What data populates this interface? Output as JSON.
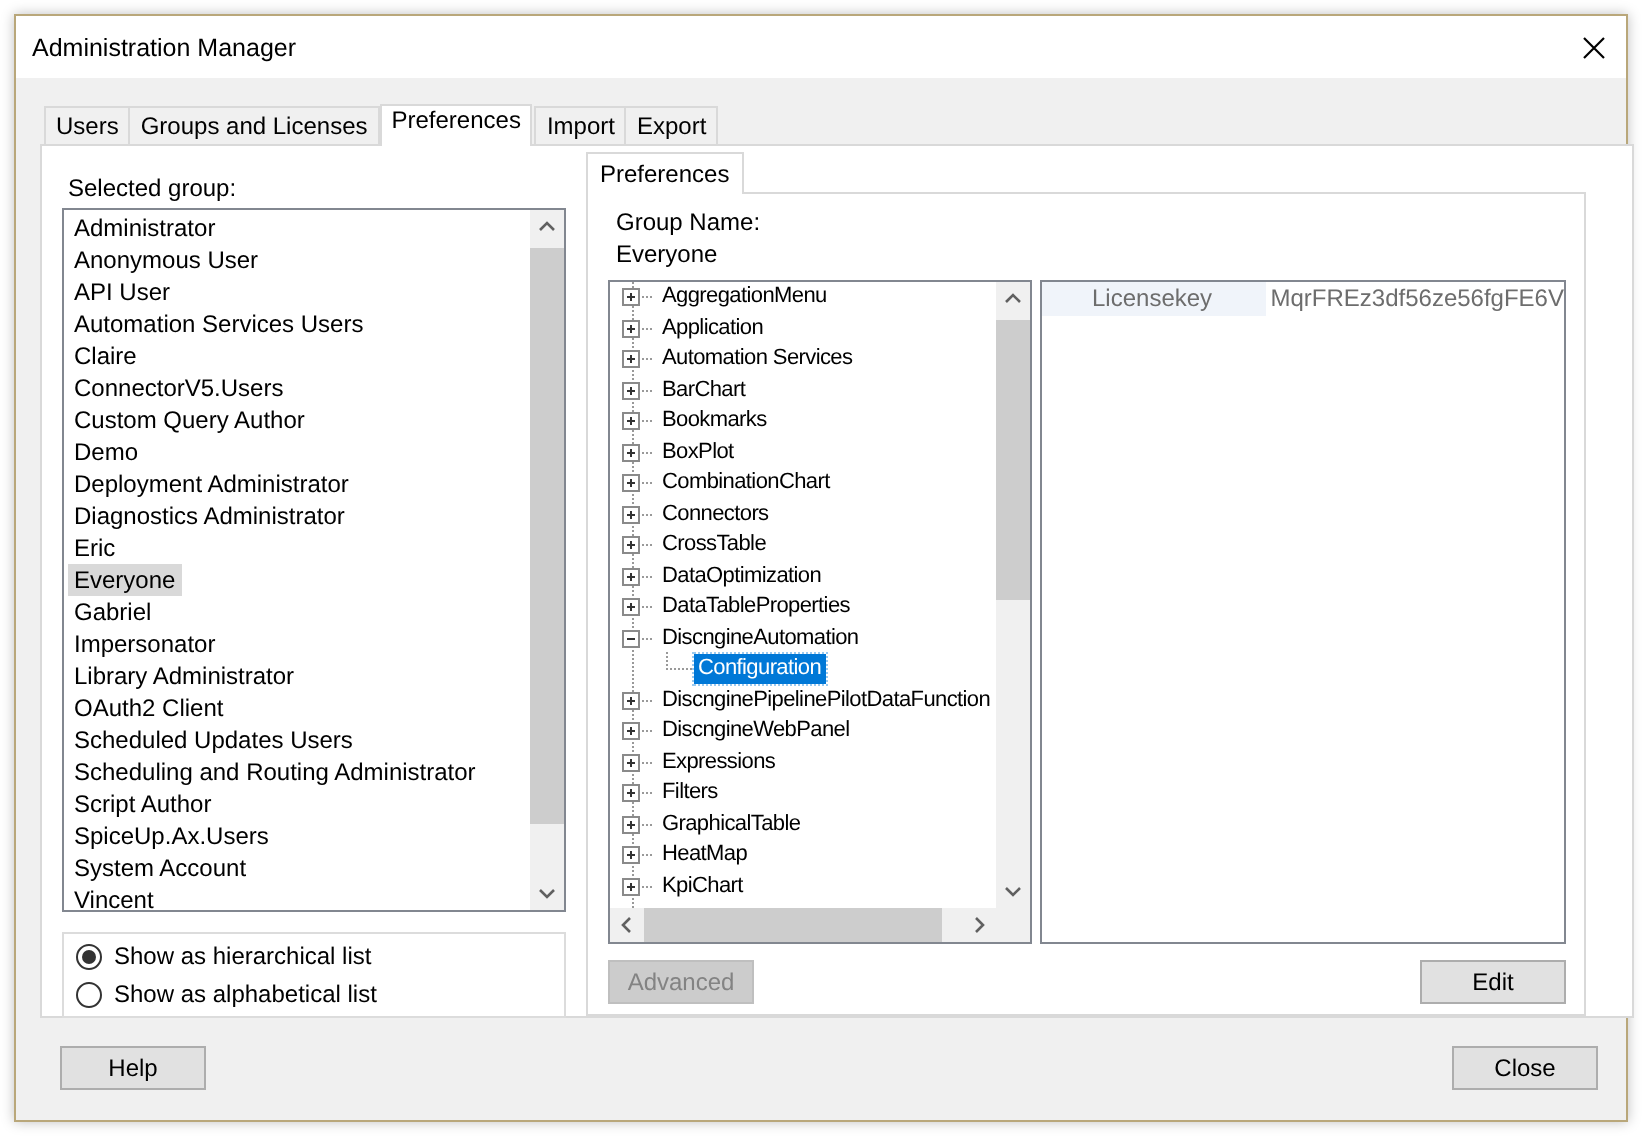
{
  "window": {
    "title": "Administration Manager"
  },
  "tabs": [
    {
      "label": "Users",
      "selected": false
    },
    {
      "label": "Groups and Licenses",
      "selected": false
    },
    {
      "label": "Preferences",
      "selected": true
    },
    {
      "label": "Import",
      "selected": false
    },
    {
      "label": "Export",
      "selected": false
    }
  ],
  "groups": {
    "label": "Selected group:",
    "items": [
      {
        "label": "Administrator",
        "selected": false
      },
      {
        "label": "Anonymous User",
        "selected": false
      },
      {
        "label": "API User",
        "selected": false
      },
      {
        "label": "Automation Services Users",
        "selected": false
      },
      {
        "label": "Claire",
        "selected": false
      },
      {
        "label": "ConnectorV5.Users",
        "selected": false
      },
      {
        "label": "Custom Query Author",
        "selected": false
      },
      {
        "label": "Demo",
        "selected": false
      },
      {
        "label": "Deployment Administrator",
        "selected": false
      },
      {
        "label": "Diagnostics Administrator",
        "selected": false
      },
      {
        "label": "Eric",
        "selected": false
      },
      {
        "label": "Everyone",
        "selected": true
      },
      {
        "label": "Gabriel",
        "selected": false
      },
      {
        "label": "Impersonator",
        "selected": false
      },
      {
        "label": "Library Administrator",
        "selected": false
      },
      {
        "label": "OAuth2 Client",
        "selected": false
      },
      {
        "label": "Scheduled Updates Users",
        "selected": false
      },
      {
        "label": "Scheduling and Routing Administrator",
        "selected": false
      },
      {
        "label": "Script Author",
        "selected": false
      },
      {
        "label": "SpiceUp.Ax.Users",
        "selected": false
      },
      {
        "label": "System Account",
        "selected": false
      },
      {
        "label": "Vincent",
        "selected": false
      }
    ]
  },
  "view_options": [
    {
      "label": "Show as hierarchical list",
      "selected": true
    },
    {
      "label": "Show as alphabetical list",
      "selected": false
    }
  ],
  "preferences": {
    "tab": "Preferences",
    "group_name_label": "Group Name:",
    "group_name": "Everyone",
    "tree": [
      {
        "label": "AggregationMenu",
        "expanded": false,
        "selected": false
      },
      {
        "label": "Application",
        "expanded": false,
        "selected": false
      },
      {
        "label": "Automation Services",
        "expanded": false,
        "selected": false
      },
      {
        "label": "BarChart",
        "expanded": false,
        "selected": false
      },
      {
        "label": "Bookmarks",
        "expanded": false,
        "selected": false
      },
      {
        "label": "BoxPlot",
        "expanded": false,
        "selected": false
      },
      {
        "label": "CombinationChart",
        "expanded": false,
        "selected": false
      },
      {
        "label": "Connectors",
        "expanded": false,
        "selected": false
      },
      {
        "label": "CrossTable",
        "expanded": false,
        "selected": false
      },
      {
        "label": "DataOptimization",
        "expanded": false,
        "selected": false
      },
      {
        "label": "DataTableProperties",
        "expanded": false,
        "selected": false
      },
      {
        "label": "DiscngineAutomation",
        "expanded": true,
        "selected": false,
        "children": [
          {
            "label": "Configuration",
            "selected": true
          }
        ]
      },
      {
        "label": "DiscnginePipelinePilotDataFunction",
        "expanded": false,
        "selected": false
      },
      {
        "label": "DiscngineWebPanel",
        "expanded": false,
        "selected": false
      },
      {
        "label": "Expressions",
        "expanded": false,
        "selected": false
      },
      {
        "label": "Filters",
        "expanded": false,
        "selected": false
      },
      {
        "label": "GraphicalTable",
        "expanded": false,
        "selected": false
      },
      {
        "label": "HeatMap",
        "expanded": false,
        "selected": false
      },
      {
        "label": "KpiChart",
        "expanded": false,
        "selected": false
      }
    ],
    "properties": [
      {
        "name": "Licensekey",
        "value": "MqrFREz3df56ze56fgFE6V"
      }
    ],
    "advanced_button": {
      "label": "Advanced",
      "disabled": true
    },
    "edit_button": {
      "label": "Edit",
      "disabled": false
    }
  },
  "buttons": {
    "help": "Help",
    "close": "Close"
  }
}
